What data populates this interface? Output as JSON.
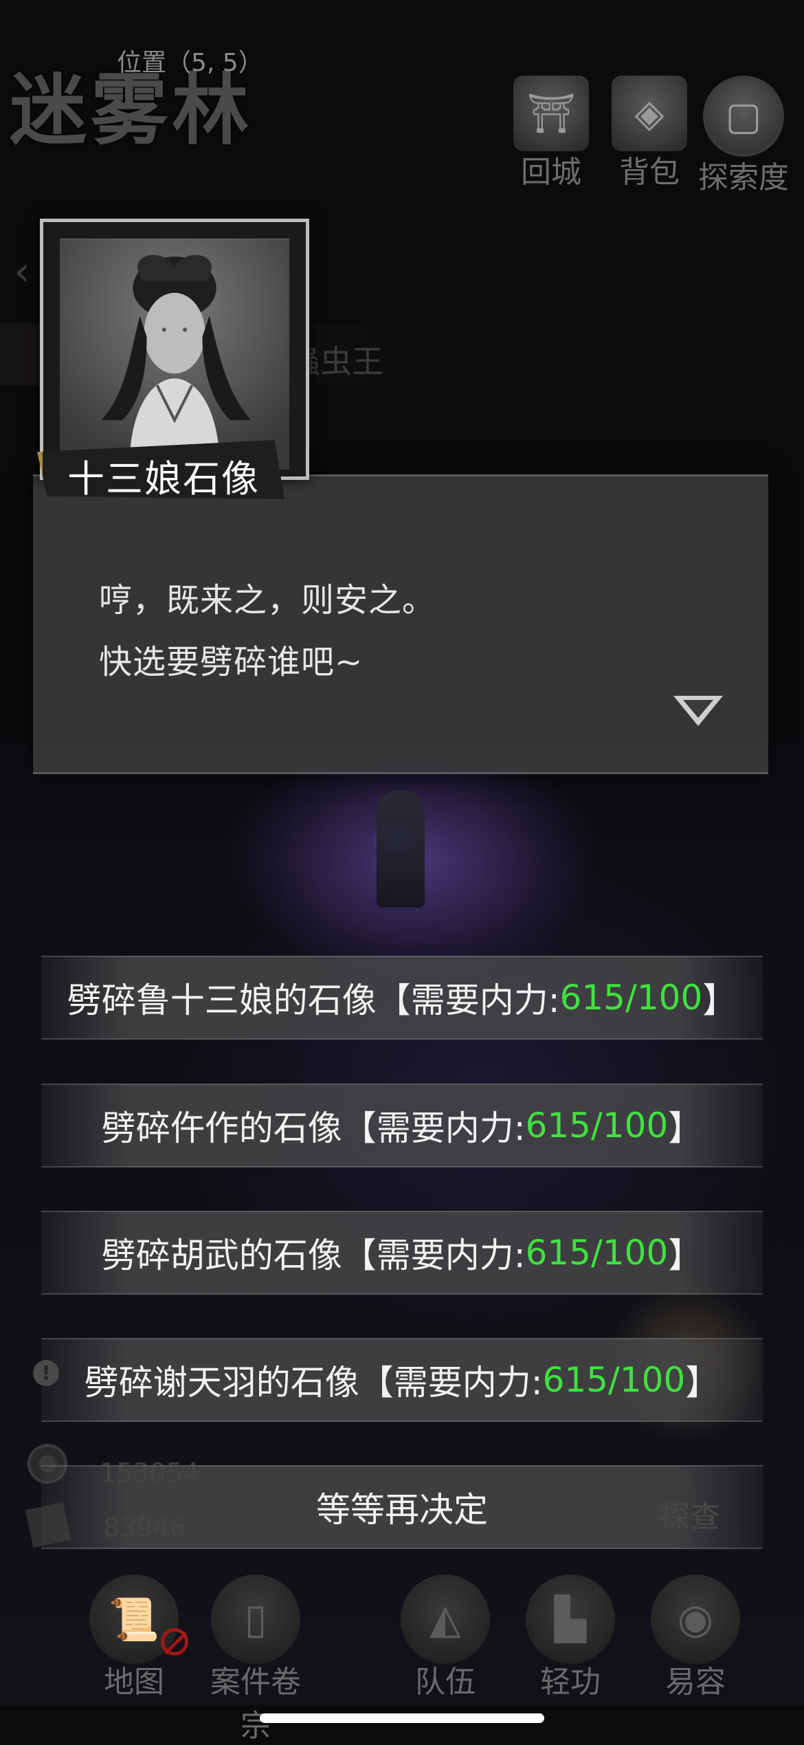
{
  "header": {
    "location": "位置（5, 5）",
    "area_title": "迷雾林",
    "buttons": [
      {
        "label": "回城",
        "icon": "city-gate-icon"
      },
      {
        "label": "背包",
        "icon": "bag-icon"
      },
      {
        "label": "探索度",
        "icon": "explore-icon"
      }
    ]
  },
  "background": {
    "hidden_bar_text": "蟲虫王"
  },
  "dialog": {
    "speaker": "十三娘石像",
    "lines": [
      "哼，既来之，则安之。",
      "快选要劈碎谁吧~"
    ]
  },
  "choices": [
    {
      "prefix": "劈碎鲁十三娘的石像【需要内力:",
      "value": "615/100",
      "suffix": "】"
    },
    {
      "prefix": "劈碎仵作的石像【需要内力:",
      "value": "615/100",
      "suffix": "】"
    },
    {
      "prefix": "劈碎胡武的石像【需要内力:",
      "value": "615/100",
      "suffix": "】"
    },
    {
      "prefix": "劈碎谢天羽的石像【需要内力:",
      "value": "615/100",
      "suffix": "】"
    },
    {
      "prefix": "等等再决定",
      "value": "",
      "suffix": ""
    }
  ],
  "stats": {
    "coins": "153054",
    "secondary": "83946",
    "explore_label": "探查"
  },
  "bottom_nav": [
    {
      "label": "地图",
      "icon": "map-scroll-icon"
    },
    {
      "label": "案件卷宗",
      "icon": "case-file-icon"
    },
    {
      "label": "队伍",
      "icon": "team-icon"
    },
    {
      "label": "轻功",
      "icon": "boot-icon"
    },
    {
      "label": "易容",
      "icon": "mask-icon"
    }
  ],
  "colors": {
    "value_green": "#3fe23f",
    "background": "#0b0b0d"
  }
}
